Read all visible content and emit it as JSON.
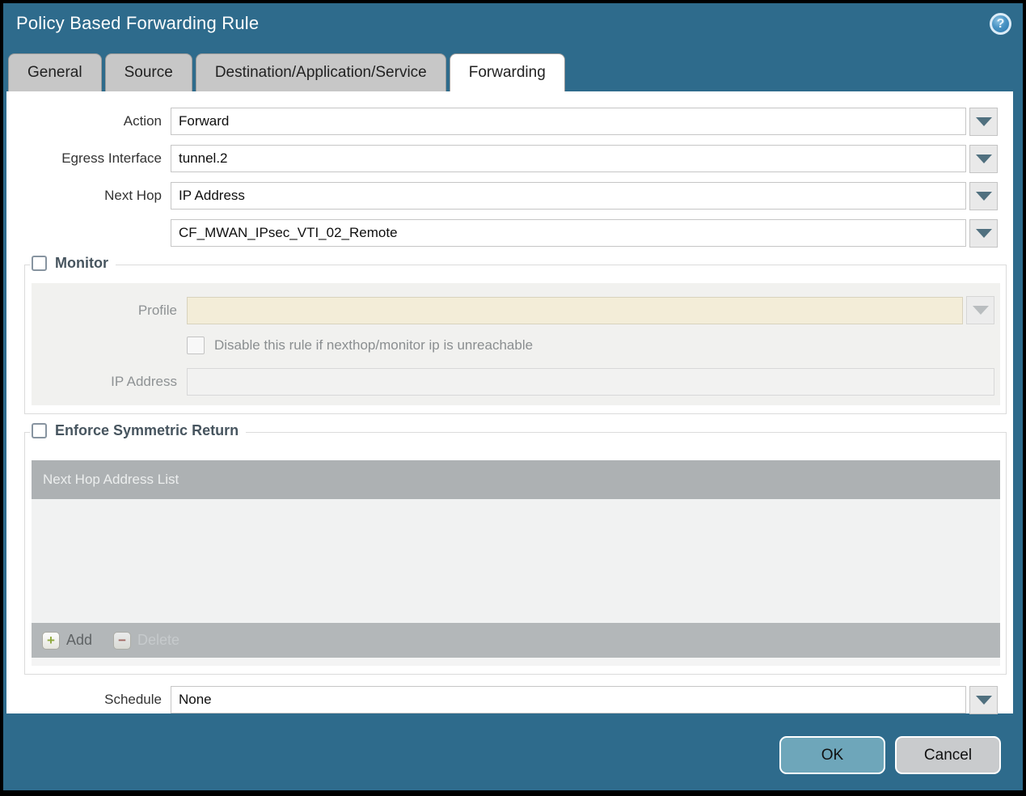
{
  "window": {
    "title": "Policy Based Forwarding Rule",
    "help_glyph": "?",
    "ok_label": "OK",
    "cancel_label": "Cancel"
  },
  "tabs": [
    {
      "label": "General",
      "active": false
    },
    {
      "label": "Source",
      "active": false
    },
    {
      "label": "Destination/Application/Service",
      "active": false
    },
    {
      "label": "Forwarding",
      "active": true
    }
  ],
  "form": {
    "action": {
      "label": "Action",
      "value": "Forward"
    },
    "egress_interface": {
      "label": "Egress Interface",
      "value": "tunnel.2"
    },
    "next_hop": {
      "label": "Next Hop",
      "value": "IP Address"
    },
    "next_hop_address": {
      "value": "CF_MWAN_IPsec_VTI_02_Remote"
    },
    "schedule": {
      "label": "Schedule",
      "value": "None"
    }
  },
  "monitor": {
    "legend": "Monitor",
    "checked": false,
    "profile": {
      "label": "Profile",
      "value": ""
    },
    "disable_rule": {
      "label": "Disable this rule if nexthop/monitor ip is unreachable",
      "checked": false
    },
    "ip_address": {
      "label": "IP Address",
      "value": ""
    }
  },
  "symmetric_return": {
    "legend": "Enforce Symmetric Return",
    "checked": false,
    "table": {
      "header": "Next Hop Address List",
      "rows": []
    },
    "add_label": "Add",
    "delete_label": "Delete"
  },
  "colors": {
    "window_bg": "#2e6b8c",
    "tab_inactive": "#c7c7c7",
    "legend_text": "#47555f",
    "disabled_field_cream": "#f3edd8",
    "table_header_bg": "#adb1b3",
    "ok_button_bg": "#6ea6ba",
    "cancel_button_bg": "#c9cbcd"
  }
}
